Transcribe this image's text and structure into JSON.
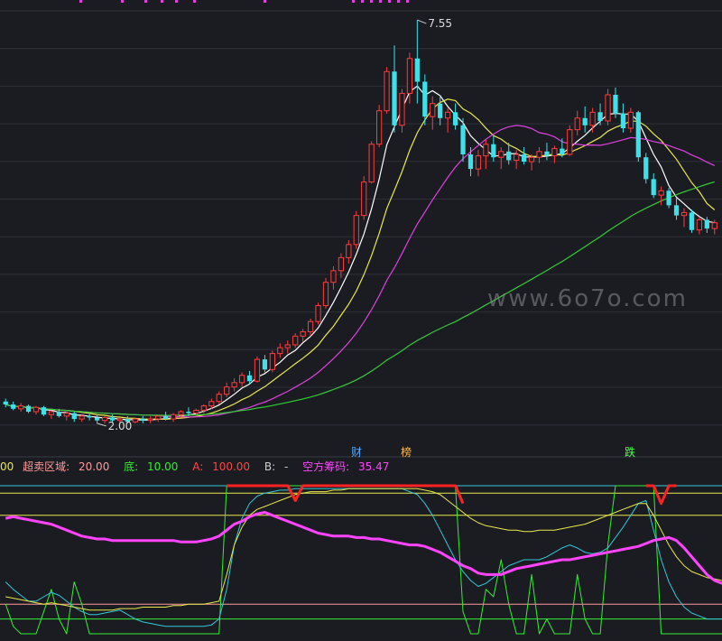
{
  "chart_data": [
    {
      "type": "candlestick",
      "price_annotations": {
        "high_label": "7.55",
        "low_label": "2.00"
      },
      "event_flags": [
        {
          "label": "财",
          "color": "#4aa8ff",
          "index": 47
        },
        {
          "label": "榜",
          "color": "#ffb84a",
          "index": 54
        },
        {
          "label": "跌",
          "color": "#4cff4c",
          "index": 83
        }
      ],
      "series": [
        {
          "color": "#ffffff",
          "kind": "ma_fast"
        },
        {
          "color": "#e8e84a",
          "kind": "ma_mid"
        },
        {
          "color": "#e040e0",
          "kind": "ma_slow"
        },
        {
          "color": "#33cc33",
          "kind": "ma_long"
        }
      ],
      "ohlc": [
        [
          2.3,
          2.34,
          2.22,
          2.26
        ],
        [
          2.26,
          2.3,
          2.18,
          2.2
        ],
        [
          2.2,
          2.28,
          2.16,
          2.24
        ],
        [
          2.24,
          2.26,
          2.14,
          2.16
        ],
        [
          2.16,
          2.24,
          2.12,
          2.22
        ],
        [
          2.22,
          2.24,
          2.1,
          2.12
        ],
        [
          2.12,
          2.18,
          2.06,
          2.16
        ],
        [
          2.16,
          2.2,
          2.08,
          2.1
        ],
        [
          2.1,
          2.16,
          2.04,
          2.14
        ],
        [
          2.14,
          2.16,
          2.02,
          2.06
        ],
        [
          2.06,
          2.12,
          2.02,
          2.1
        ],
        [
          2.1,
          2.14,
          2.04,
          2.08
        ],
        [
          2.08,
          2.12,
          2.0,
          2.04
        ],
        [
          2.04,
          2.1,
          2.0,
          2.08
        ],
        [
          2.08,
          2.12,
          2.02,
          2.04
        ],
        [
          2.04,
          2.08,
          2.0,
          2.06
        ],
        [
          2.06,
          2.1,
          2.0,
          2.02
        ],
        [
          2.02,
          2.08,
          2.0,
          2.06
        ],
        [
          2.06,
          2.1,
          2.0,
          2.04
        ],
        [
          2.04,
          2.1,
          2.0,
          2.06
        ],
        [
          2.06,
          2.12,
          2.02,
          2.1
        ],
        [
          2.1,
          2.16,
          2.04,
          2.06
        ],
        [
          2.06,
          2.14,
          2.02,
          2.12
        ],
        [
          2.12,
          2.18,
          2.08,
          2.16
        ],
        [
          2.16,
          2.22,
          2.1,
          2.14
        ],
        [
          2.14,
          2.2,
          2.1,
          2.18
        ],
        [
          2.18,
          2.26,
          2.14,
          2.24
        ],
        [
          2.24,
          2.34,
          2.2,
          2.3
        ],
        [
          2.3,
          2.44,
          2.26,
          2.4
        ],
        [
          2.4,
          2.56,
          2.36,
          2.5
        ],
        [
          2.5,
          2.62,
          2.44,
          2.56
        ],
        [
          2.56,
          2.7,
          2.5,
          2.66
        ],
        [
          2.66,
          2.72,
          2.54,
          2.58
        ],
        [
          2.58,
          2.92,
          2.56,
          2.88
        ],
        [
          2.88,
          2.94,
          2.7,
          2.74
        ],
        [
          2.74,
          3.0,
          2.7,
          2.96
        ],
        [
          2.96,
          3.1,
          2.9,
          3.04
        ],
        [
          3.04,
          3.14,
          2.96,
          3.08
        ],
        [
          3.08,
          3.24,
          3.04,
          3.2
        ],
        [
          3.2,
          3.3,
          3.12,
          3.26
        ],
        [
          3.26,
          3.44,
          3.2,
          3.4
        ],
        [
          3.4,
          3.66,
          3.36,
          3.62
        ],
        [
          3.62,
          4.0,
          3.58,
          3.94
        ],
        [
          3.94,
          4.16,
          3.84,
          4.1
        ],
        [
          4.1,
          4.34,
          4.0,
          4.28
        ],
        [
          4.28,
          4.52,
          4.2,
          4.46
        ],
        [
          4.46,
          4.92,
          4.4,
          4.86
        ],
        [
          4.86,
          5.4,
          4.8,
          5.32
        ],
        [
          5.32,
          5.88,
          5.3,
          5.84
        ],
        [
          5.84,
          6.38,
          5.8,
          6.3
        ],
        [
          6.3,
          6.9,
          6.26,
          6.84
        ],
        [
          6.84,
          7.2,
          6.0,
          6.1
        ],
        [
          6.1,
          6.6,
          6.0,
          6.54
        ],
        [
          6.54,
          7.1,
          6.4,
          7.02
        ],
        [
          7.02,
          7.55,
          6.4,
          6.7
        ],
        [
          6.7,
          6.8,
          6.1,
          6.22
        ],
        [
          6.22,
          6.5,
          6.04,
          6.4
        ],
        [
          6.4,
          6.52,
          6.1,
          6.2
        ],
        [
          6.2,
          6.34,
          6.0,
          6.28
        ],
        [
          6.28,
          6.4,
          6.04,
          6.1
        ],
        [
          6.1,
          6.2,
          5.6,
          5.7
        ],
        [
          5.7,
          5.8,
          5.4,
          5.5
        ],
        [
          5.5,
          5.76,
          5.4,
          5.68
        ],
        [
          5.68,
          5.9,
          5.5,
          5.84
        ],
        [
          5.84,
          5.96,
          5.6,
          5.66
        ],
        [
          5.66,
          5.8,
          5.5,
          5.74
        ],
        [
          5.74,
          5.86,
          5.56,
          5.62
        ],
        [
          5.62,
          5.76,
          5.5,
          5.7
        ],
        [
          5.7,
          5.8,
          5.56,
          5.6
        ],
        [
          5.6,
          5.7,
          5.48,
          5.66
        ],
        [
          5.66,
          5.8,
          5.58,
          5.74
        ],
        [
          5.74,
          5.86,
          5.62,
          5.68
        ],
        [
          5.68,
          5.82,
          5.58,
          5.78
        ],
        [
          5.78,
          5.92,
          5.66,
          5.7
        ],
        [
          5.7,
          6.1,
          5.68,
          6.04
        ],
        [
          6.04,
          6.3,
          5.96,
          6.2
        ],
        [
          6.2,
          6.36,
          6.0,
          6.1
        ],
        [
          6.1,
          6.34,
          6.0,
          6.28
        ],
        [
          6.28,
          6.4,
          6.1,
          6.16
        ],
        [
          6.16,
          6.6,
          6.1,
          6.52
        ],
        [
          6.52,
          6.62,
          6.2,
          6.26
        ],
        [
          6.26,
          6.4,
          6.0,
          6.06
        ],
        [
          6.06,
          6.34,
          6.0,
          6.28
        ],
        [
          6.28,
          6.3,
          5.6,
          5.66
        ],
        [
          5.66,
          5.72,
          5.3,
          5.36
        ],
        [
          5.36,
          5.44,
          5.1,
          5.14
        ],
        [
          5.14,
          5.26,
          5.0,
          5.2
        ],
        [
          5.2,
          5.24,
          4.96,
          5.0
        ],
        [
          5.0,
          5.1,
          4.8,
          4.86
        ],
        [
          4.86,
          4.96,
          4.7,
          4.9
        ],
        [
          4.9,
          4.94,
          4.62,
          4.66
        ],
        [
          4.66,
          4.84,
          4.6,
          4.8
        ],
        [
          4.8,
          4.84,
          4.62,
          4.68
        ],
        [
          4.68,
          4.8,
          4.6,
          4.76
        ]
      ]
    },
    {
      "type": "line",
      "header": {
        "cut_prefix": "00",
        "items": [
          {
            "label": "超卖区域: ",
            "value": "20.00",
            "color": "#ff9a9a"
          },
          {
            "label": "底: ",
            "value": "10.00",
            "color": "#33ee33"
          },
          {
            "label": "A: ",
            "value": "100.00",
            "color": "#ff4444"
          },
          {
            "label": "B: ",
            "value": "-",
            "color": "#cccccc"
          },
          {
            "label": "空方筹码: ",
            "value": "35.47",
            "color": "#ff44ff"
          }
        ]
      },
      "ylim": [
        0,
        100
      ],
      "reference_lines": [
        {
          "y": 100,
          "color": "#30c8d8"
        },
        {
          "y": 95,
          "color": "#e8e84a"
        },
        {
          "y": 80,
          "color": "#e8e84a"
        },
        {
          "y": 20,
          "color": "#ff9a9a"
        },
        {
          "y": 10,
          "color": "#33ee33"
        }
      ],
      "series": [
        {
          "color": "#ff2222",
          "kind": "A",
          "values": [
            null,
            null,
            null,
            null,
            null,
            null,
            null,
            null,
            null,
            null,
            null,
            null,
            null,
            null,
            null,
            null,
            null,
            null,
            null,
            null,
            null,
            null,
            null,
            null,
            null,
            null,
            null,
            null,
            null,
            100,
            100,
            100,
            100,
            100,
            100,
            100,
            100,
            100,
            90,
            100,
            100,
            100,
            100,
            100,
            100,
            100,
            100,
            100,
            100,
            100,
            100,
            100,
            100,
            100,
            100,
            100,
            100,
            100,
            100,
            100,
            88,
            null,
            null,
            null,
            null,
            null,
            null,
            null,
            null,
            null,
            null,
            null,
            null,
            null,
            null,
            null,
            null,
            null,
            null,
            null,
            null,
            null,
            null,
            null,
            100,
            100,
            88,
            100,
            100,
            null,
            null,
            null,
            null,
            null,
            null,
            null,
            null,
            null,
            null,
            null,
            null,
            null
          ]
        },
        {
          "color": "#ff44ff",
          "kind": "B",
          "values": [
            78,
            79,
            78,
            77,
            76,
            75,
            74,
            72,
            70,
            68,
            66,
            65,
            64,
            64,
            63,
            63,
            63,
            63,
            63,
            63,
            63,
            63,
            63,
            62,
            62,
            62,
            63,
            64,
            66,
            70,
            74,
            76,
            79,
            81,
            82,
            80,
            78,
            76,
            74,
            72,
            70,
            68,
            67,
            66,
            66,
            66,
            65,
            65,
            64,
            64,
            63,
            62,
            61,
            60,
            60,
            59,
            57,
            55,
            52,
            49,
            46,
            44,
            41,
            40,
            40,
            40,
            42,
            44,
            45,
            46,
            47,
            48,
            49,
            50,
            50,
            51,
            52,
            53,
            54,
            55,
            56,
            57,
            58,
            59,
            61,
            63,
            64,
            65,
            63,
            58,
            52,
            46,
            40,
            36,
            34,
            33,
            32,
            31,
            30,
            32,
            33,
            34,
            35
          ]
        },
        {
          "color": "#e8e84a",
          "kind": "C",
          "values": [
            25,
            24,
            23,
            22,
            21,
            20,
            21,
            20,
            19,
            18,
            17,
            16,
            16,
            16,
            16,
            17,
            17,
            17,
            18,
            18,
            18,
            18,
            19,
            19,
            20,
            20,
            20,
            21,
            22,
            40,
            60,
            72,
            80,
            84,
            86,
            88,
            90,
            92,
            94,
            95,
            96,
            96,
            96,
            97,
            97,
            98,
            98,
            98,
            98,
            98,
            98,
            98,
            98,
            98,
            98,
            97,
            96,
            94,
            90,
            86,
            82,
            78,
            75,
            73,
            72,
            71,
            70,
            70,
            69,
            69,
            70,
            70,
            70,
            71,
            72,
            73,
            74,
            76,
            78,
            80,
            82,
            84,
            86,
            88,
            88,
            80,
            70,
            60,
            52,
            46,
            42,
            40,
            38,
            37,
            36,
            36,
            35,
            35,
            35,
            35,
            35,
            35,
            35
          ]
        },
        {
          "color": "#30c8d8",
          "kind": "D",
          "values": [
            35,
            30,
            26,
            22,
            22,
            25,
            28,
            26,
            22,
            18,
            15,
            13,
            13,
            14,
            15,
            16,
            13,
            10,
            8,
            7,
            6,
            5,
            5,
            5,
            5,
            5,
            5,
            6,
            10,
            30,
            60,
            78,
            88,
            93,
            95,
            96,
            97,
            97,
            98,
            98,
            98,
            98,
            98,
            98,
            98,
            98,
            98,
            98,
            98,
            98,
            98,
            98,
            98,
            96,
            94,
            88,
            80,
            70,
            60,
            50,
            42,
            36,
            32,
            34,
            38,
            42,
            46,
            48,
            50,
            50,
            50,
            52,
            55,
            58,
            60,
            58,
            55,
            54,
            55,
            58,
            65,
            72,
            80,
            88,
            90,
            70,
            50,
            35,
            25,
            18,
            14,
            12,
            10,
            10,
            10,
            10,
            10,
            10,
            10,
            10,
            10,
            10,
            10
          ]
        },
        {
          "color": "#33ee33",
          "kind": "E",
          "values": [
            20,
            5,
            0,
            0,
            0,
            15,
            30,
            10,
            0,
            35,
            20,
            0,
            0,
            0,
            0,
            0,
            0,
            0,
            0,
            0,
            0,
            0,
            0,
            0,
            0,
            0,
            0,
            0,
            0,
            100,
            100,
            100,
            100,
            100,
            100,
            100,
            100,
            100,
            100,
            100,
            100,
            100,
            100,
            100,
            100,
            100,
            100,
            100,
            100,
            100,
            100,
            100,
            100,
            100,
            100,
            100,
            100,
            100,
            100,
            100,
            15,
            0,
            0,
            30,
            25,
            50,
            20,
            0,
            0,
            40,
            0,
            10,
            0,
            0,
            0,
            40,
            10,
            0,
            0,
            60,
            100,
            100,
            100,
            100,
            100,
            100,
            0,
            0,
            0,
            0,
            0,
            0,
            0,
            0,
            0,
            0,
            0,
            0,
            0,
            0,
            0,
            10,
            10
          ]
        }
      ]
    }
  ],
  "watermark": "www.6o7o.com"
}
